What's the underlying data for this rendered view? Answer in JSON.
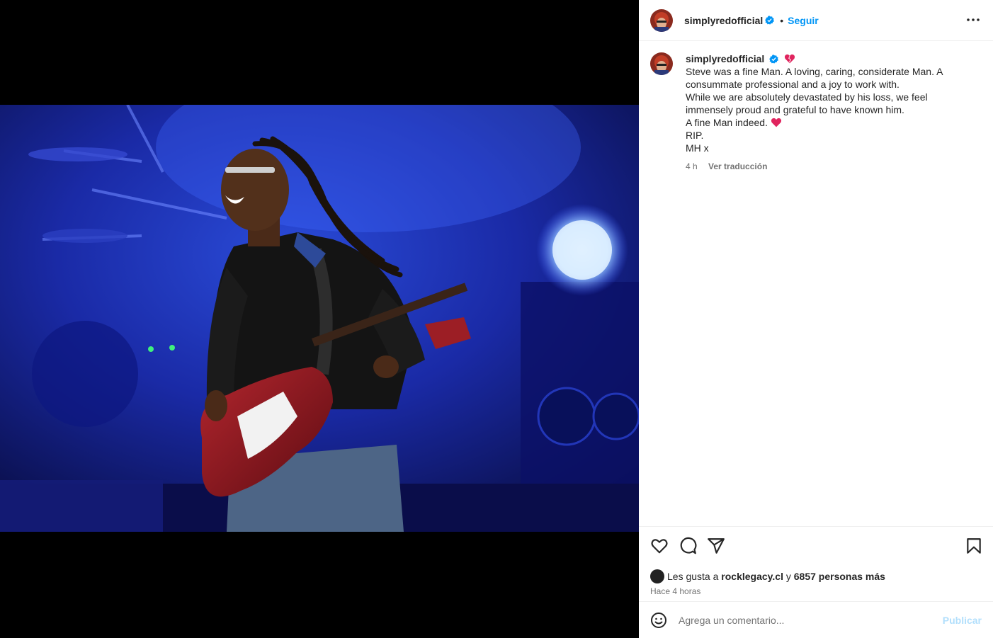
{
  "post": {
    "username": "simplyredofficial",
    "follow_label": "Seguir",
    "dot": "•",
    "caption_lines": [
      "Steve was a fine Man. A loving, caring, considerate Man. A",
      "consummate professional and a joy to work with.",
      "While we are absolutely devastated by his loss, we feel",
      "immensely proud and grateful to have known him.",
      "A fine Man indeed.",
      "RIP.",
      "MH x"
    ],
    "timestamp": "4 h",
    "translate_label": "Ver traducción",
    "likes_prefix": "Les gusta a",
    "likes_user": "rocklegacy.cl",
    "likes_mid": "y",
    "likes_count": "6857 personas más",
    "posted_ago": "Hace 4 horas"
  },
  "comment_box": {
    "placeholder": "Agrega un comentario...",
    "publish_label": "Publicar"
  },
  "icons": {
    "more": "more-options-icon",
    "like": "heart-icon",
    "comment": "comment-icon",
    "share": "share-icon",
    "save": "bookmark-icon",
    "emoji": "emoji-icon",
    "verified": "verified-badge-icon"
  },
  "colors": {
    "accent": "#0095f6",
    "publish_disabled": "#b2dffc",
    "emoji_heart": "#e0245e"
  }
}
